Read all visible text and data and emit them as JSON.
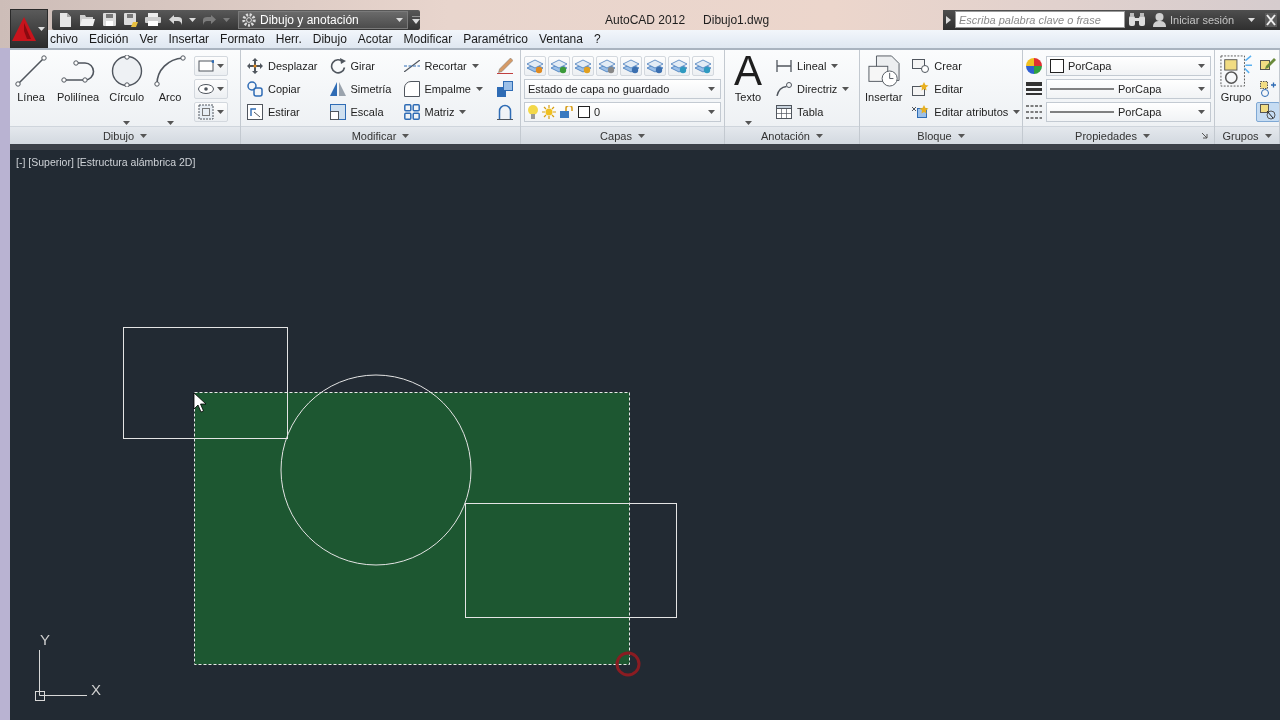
{
  "quick_access": {
    "workspace": "Dibujo y anotación",
    "redo_disabled": true
  },
  "title_bar": {
    "app": "AutoCAD 2012",
    "file": "Dibujo1.dwg"
  },
  "info_center": {
    "search_placeholder": "Escriba palabra clave o frase",
    "sign_in": "Iniciar sesión"
  },
  "menu_bar": [
    "chivo",
    "Edición",
    "Ver",
    "Insertar",
    "Formato",
    "Herr.",
    "Dibujo",
    "Acotar",
    "Modificar",
    "Paramétrico",
    "Ventana",
    "?"
  ],
  "ribbon": {
    "panels": [
      {
        "kind": "draw",
        "title": "Dibujo",
        "large_tools": [
          {
            "label": "Línea",
            "dropdown": false
          },
          {
            "label": "Polilínea",
            "dropdown": false
          },
          {
            "label": "Círculo",
            "dropdown": true
          },
          {
            "label": "Arco",
            "dropdown": true
          }
        ]
      },
      {
        "kind": "modify",
        "title": "Modificar",
        "tool_columns": [
          [
            {
              "label": "Desplazar",
              "dropdown": false
            },
            {
              "label": "Copiar",
              "dropdown": false
            },
            {
              "label": "Estirar",
              "dropdown": false
            }
          ],
          [
            {
              "label": "Girar",
              "dropdown": false
            },
            {
              "label": "Simetría",
              "dropdown": false
            },
            {
              "label": "Escala",
              "dropdown": false
            }
          ],
          [
            {
              "label": "Recortar",
              "dropdown": true
            },
            {
              "label": "Empalme",
              "dropdown": true
            },
            {
              "label": "Matriz",
              "dropdown": true
            }
          ]
        ]
      },
      {
        "kind": "layers",
        "title": "Capas",
        "layer_state": "Estado de capa no guardado",
        "current_layer": "0"
      },
      {
        "kind": "annotation",
        "title": "Anotación",
        "large_tools": [
          {
            "label": "Texto",
            "glyph": "A",
            "dropdown": true
          }
        ],
        "tool_columns": [
          [
            {
              "label": "Lineal",
              "dropdown": true
            },
            {
              "label": "Directriz",
              "dropdown": true
            },
            {
              "label": "Tabla",
              "dropdown": false
            }
          ]
        ]
      },
      {
        "kind": "block",
        "title": "Bloque",
        "large_tools": [
          {
            "label": "Insertar",
            "dropdown": false
          }
        ],
        "tool_columns": [
          [
            {
              "label": "Crear",
              "dropdown": false
            },
            {
              "label": "Editar",
              "dropdown": false
            },
            {
              "label": "Editar atributos",
              "dropdown": true
            }
          ]
        ]
      },
      {
        "kind": "properties",
        "title": "Propiedades",
        "settings": [
          {
            "kind": "color",
            "value": "PorCapa"
          },
          {
            "kind": "lineweight",
            "value": "PorCapa"
          },
          {
            "kind": "linetype",
            "value": "PorCapa"
          }
        ]
      },
      {
        "kind": "groups",
        "title": "Grupos",
        "large_tools": [
          {
            "label": "Grupo",
            "dropdown": false
          }
        ],
        "toggles": [
          {
            "on": false
          },
          {
            "on": false
          },
          {
            "on": true
          }
        ]
      }
    ]
  },
  "viewport": {
    "controls": [
      "[-]",
      "[Superior]",
      "[Estructura alámbrica 2D]"
    ]
  },
  "ucs": {
    "x_label": "X",
    "y_label": "Y"
  }
}
